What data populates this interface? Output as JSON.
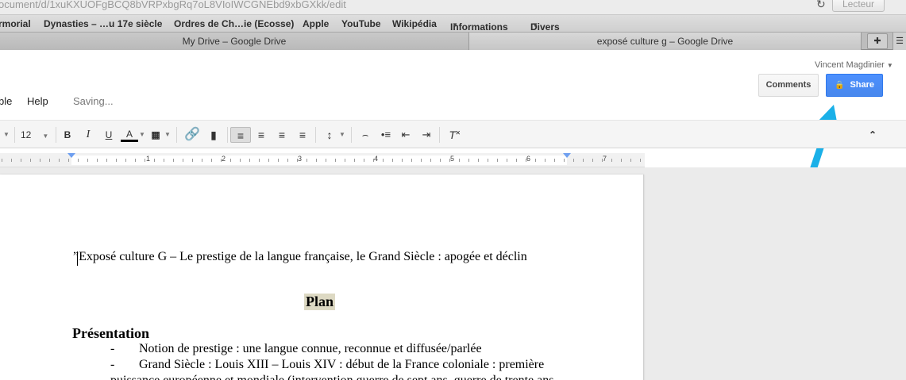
{
  "browser": {
    "url": "ocument/d/1xuKXUOFgBCQ8bVRPxbgRq7oL8VIoIWCGNEbd9xbGXkk/edit",
    "reader_label": "Lecteur",
    "bookmarks": [
      "rmorial",
      "Dynasties – …u 17e siècle",
      "Ordres de Ch…ie (Ecosse)",
      "Apple",
      "YouTube",
      "Wikipédia",
      "Informations",
      "Divers"
    ],
    "tabs": [
      "My Drive – Google Drive",
      "exposé culture g – Google Drive"
    ]
  },
  "header": {
    "user_name": "Vincent Magdinier",
    "comments_label": "Comments",
    "share_label": "Share"
  },
  "menubar": {
    "items": [
      "ble",
      "Help"
    ],
    "status": "Saving..."
  },
  "toolbar": {
    "font_size": "12"
  },
  "ruler": {
    "numbers": [
      "1",
      "2",
      "3",
      "4",
      "5",
      "6",
      "7"
    ]
  },
  "document": {
    "title_line": "”Exposé culture G – Le prestige de la langue française, le Grand Siècle : apogée et déclin",
    "plan_heading": "Plan",
    "section_heading": "Présentation",
    "bullet_dash": "-",
    "bullets": [
      "Notion de prestige : une langue connue, reconnue et diffusée/parlée",
      "Grand Siècle : Louis XIII – Louis XIV : début de la France coloniale : première"
    ],
    "continuation": "puissance européenne et mondiale (intervention guerre de sept ans, guerre de trente ans"
  },
  "colors": {
    "share_blue": "#4d90fe",
    "annotation_arrow": "#1ab0e8",
    "plan_highlight": "#ddd9c3"
  }
}
